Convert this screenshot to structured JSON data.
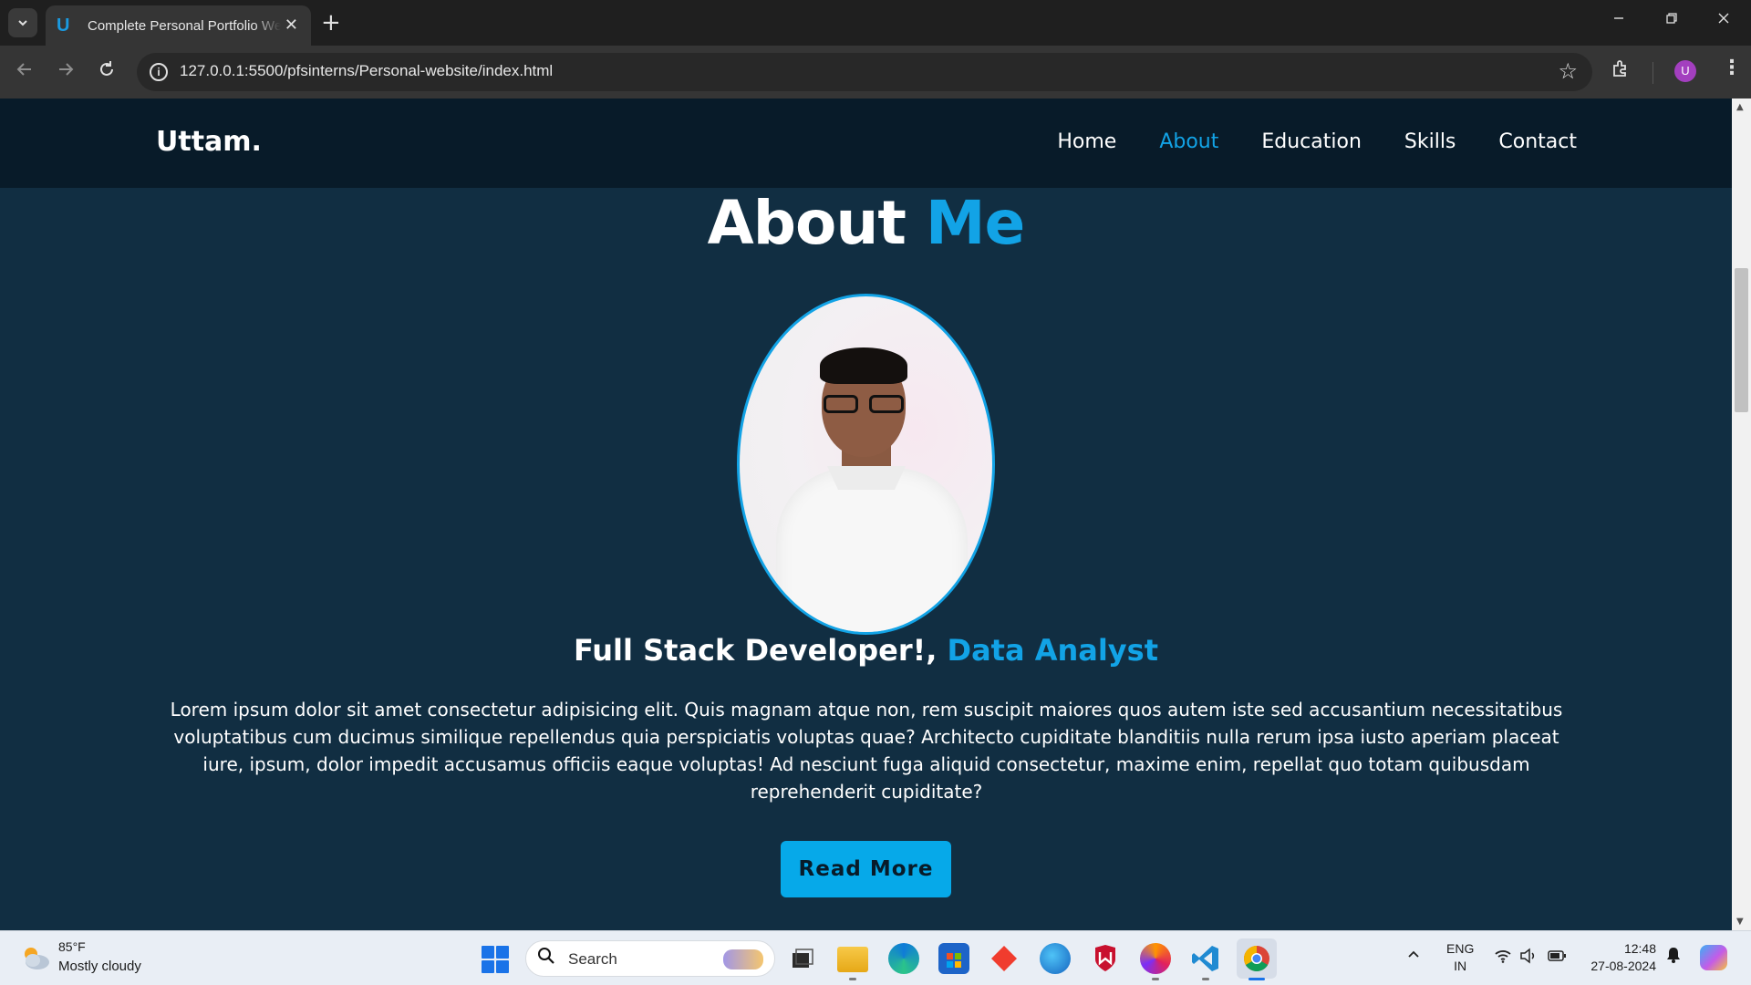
{
  "browser": {
    "tab_title": "Complete Personal Portfolio Website",
    "tab_favicon": "U",
    "new_tab_symbol": "+",
    "tab_close_symbol": "✕",
    "url": "127.0.0.1:5500/pfsinterns/Personal-website/index.html",
    "profile_initial": "U",
    "icons": [
      "tab-list-icon",
      "back-icon",
      "forward-icon",
      "reload-icon",
      "site-info-icon",
      "bookmark-star-icon",
      "extensions-icon",
      "menu-icon",
      "minimize-icon",
      "restore-icon",
      "close-icon"
    ]
  },
  "site": {
    "logo": "Uttam.",
    "nav": [
      {
        "label": "Home",
        "active": false
      },
      {
        "label": "About",
        "active": true
      },
      {
        "label": "Education",
        "active": false
      },
      {
        "label": "Skills",
        "active": false
      },
      {
        "label": "Contact",
        "active": false
      }
    ],
    "about_title_part1": "About ",
    "about_title_part2": "Me",
    "role_part1": "Full Stack Developer!, ",
    "role_part2": "Data Analyst",
    "bio": "Lorem ipsum dolor sit amet consectetur adipisicing elit. Quis magnam atque non, rem suscipit maiores quos autem iste sed accusantium necessitatibus voluptatibus cum ducimus similique repellendus quia perspiciatis voluptas quae? Architecto cupiditate blanditiis nulla rerum ipsa iusto aperiam placeat iure, ipsum, dolor impedit accusamus officiis eaque voluptas! Ad nesciunt fuga aliquid consectetur, maxime enim, repellat quo totam quibusdam reprehenderit cupiditate?",
    "read_more": "Read More",
    "accent_color": "#12a3e6",
    "background_color": "#112e42",
    "header_color": "#081b29"
  },
  "taskbar": {
    "weather_temp": "85°F",
    "weather_desc": "Mostly cloudy",
    "search_placeholder": "Search",
    "lang_line1": "ENG",
    "lang_line2": "IN",
    "time": "12:48",
    "date": "27-08-2024",
    "apps": [
      "task-view-icon",
      "file-explorer-icon",
      "edge-icon",
      "microsoft-store-icon",
      "git-icon",
      "app-icon",
      "mcafee-icon",
      "firefox-icon",
      "vscode-icon",
      "chrome-icon"
    ]
  }
}
